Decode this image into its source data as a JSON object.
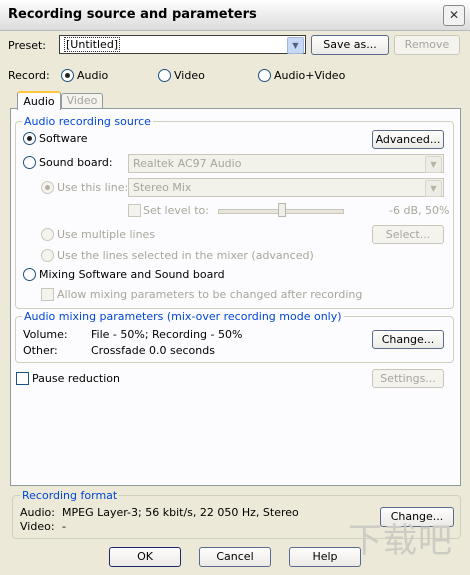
{
  "window": {
    "title": "Recording source and parameters"
  },
  "preset": {
    "label": "Preset:",
    "value": "[Untitled]",
    "save_as": "Save as...",
    "remove": "Remove"
  },
  "record": {
    "label": "Record:",
    "options": [
      "Audio",
      "Video",
      "Audio+Video"
    ],
    "selected": "Audio"
  },
  "tabs": [
    "Audio",
    "Video"
  ],
  "audio_source": {
    "title": "Audio recording source",
    "software": "Software",
    "advanced": "Advanced...",
    "sound_board": "Sound board:",
    "sound_board_value": "Realtek AC97 Audio",
    "use_this_line": "Use this line:",
    "line_value": "Stereo Mix",
    "set_level": "Set level to:",
    "level_value": "-6 dB, 50%",
    "level_fraction": 0.5,
    "use_multiple": "Use multiple lines",
    "select": "Select...",
    "use_mixer_lines": "Use the lines selected in the mixer (advanced)",
    "mixing": "Mixing Software and Sound board",
    "allow_mixing": "Allow mixing parameters to be changed after recording"
  },
  "mix_params": {
    "title": "Audio mixing parameters (mix-over recording mode only)",
    "volume_label": "Volume:",
    "volume_value": "File - 50%; Recording - 50%",
    "other_label": "Other:",
    "other_value": "Crossfade 0.0 seconds",
    "change": "Change..."
  },
  "pause": {
    "label": "Pause reduction",
    "settings": "Settings..."
  },
  "format": {
    "title": "Recording format",
    "audio_label": "Audio:",
    "audio_value": "MPEG Layer-3; 56 kbit/s, 22 050 Hz, Stereo",
    "video_label": "Video:",
    "video_value": "-",
    "change": "Change..."
  },
  "buttons": {
    "ok": "OK",
    "cancel": "Cancel",
    "help": "Help"
  },
  "close_glyph": "✕",
  "watermark": "下载吧"
}
